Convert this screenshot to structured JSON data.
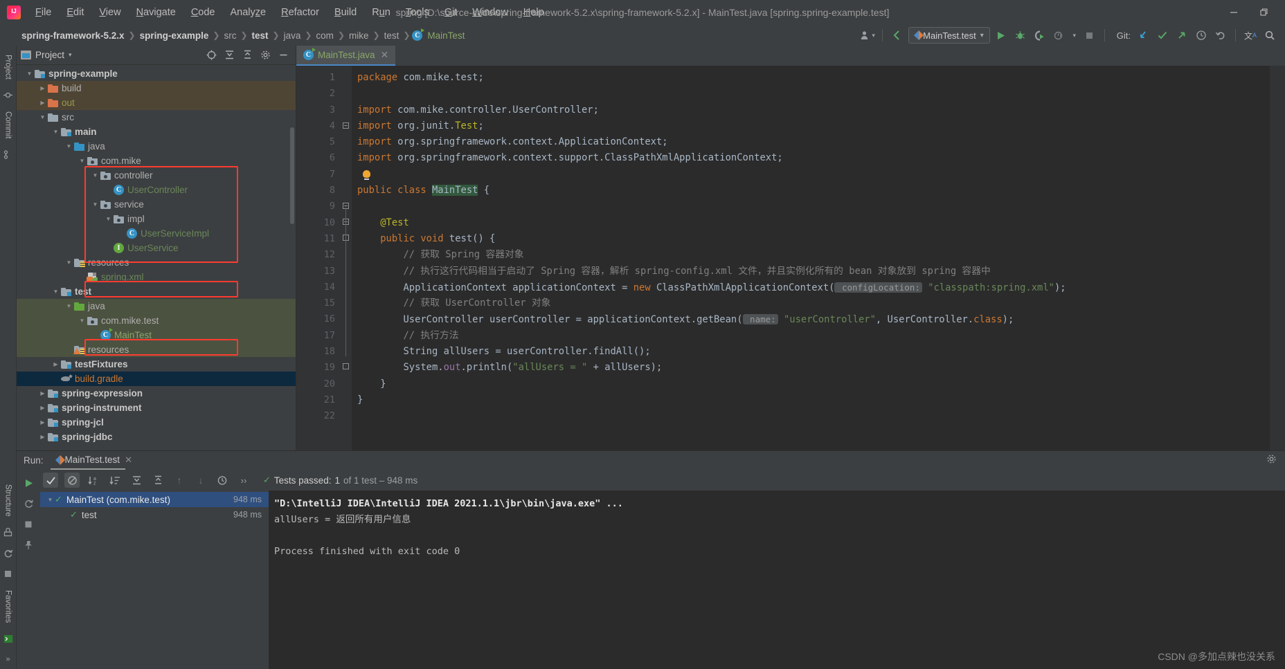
{
  "window": {
    "title": "spring [D:\\source-code\\spring-framework-5.2.x\\spring-framework-5.2.x] - MainTest.java [spring.spring-example.test]",
    "minimize": "—",
    "restore": "❐"
  },
  "menubar": {
    "items": [
      {
        "label": "File",
        "mnemonic": "F"
      },
      {
        "label": "Edit",
        "mnemonic": "E"
      },
      {
        "label": "View",
        "mnemonic": "V"
      },
      {
        "label": "Navigate",
        "mnemonic": "N"
      },
      {
        "label": "Code",
        "mnemonic": "C"
      },
      {
        "label": "Analyze",
        "mnemonic": "z"
      },
      {
        "label": "Refactor",
        "mnemonic": "R"
      },
      {
        "label": "Build",
        "mnemonic": "B"
      },
      {
        "label": "Run",
        "mnemonic": "u"
      },
      {
        "label": "Tools",
        "mnemonic": "T"
      },
      {
        "label": "Git",
        "mnemonic": "G"
      },
      {
        "label": "Window",
        "mnemonic": "W"
      },
      {
        "label": "Help",
        "mnemonic": "H"
      }
    ]
  },
  "breadcrumb": {
    "items": [
      {
        "label": "spring-framework-5.2.x",
        "style": "bold"
      },
      {
        "label": "spring-example",
        "style": "bold"
      },
      {
        "label": "src",
        "style": "normal"
      },
      {
        "label": "test",
        "style": "bold"
      },
      {
        "label": "java",
        "style": "normal"
      },
      {
        "label": "com",
        "style": "normal"
      },
      {
        "label": "mike",
        "style": "normal"
      },
      {
        "label": "test",
        "style": "normal"
      },
      {
        "label": "MainTest",
        "style": "file"
      }
    ],
    "separator": "❯"
  },
  "toolbar": {
    "run_configuration": "MainTest.test",
    "dropdown_caret": "▾",
    "git_label": "Git:",
    "run_button": "▶",
    "debug_button": "🐞",
    "coverage_button": "▶",
    "profile_button": "◷",
    "stop_button": "■",
    "update_project": "↙",
    "commit": "✓",
    "push": "↗",
    "history": "◷",
    "undo": "↺",
    "translate": "文A",
    "search": "🔍"
  },
  "left_strip": {
    "tabs": [
      "Project",
      "Commit",
      "Structure",
      "Favorites"
    ]
  },
  "project_panel": {
    "title": "Project",
    "caret": "▾",
    "actions": [
      "select-opened-file-icon",
      "expand-all-icon",
      "collapse-all-icon",
      "settings-icon",
      "hide-icon"
    ],
    "tree": [
      {
        "label": "spring-example",
        "depth": 1,
        "arrow": "down",
        "icon": "module-folder",
        "bold": true,
        "color": "#c8c8c8",
        "highlight": "none"
      },
      {
        "label": "build",
        "depth": 2,
        "arrow": "right",
        "icon": "orange-folder",
        "bold": false,
        "color": "#b0b0b0",
        "highlight": "build"
      },
      {
        "label": "out",
        "depth": 2,
        "arrow": "right",
        "icon": "orange-folder",
        "bold": false,
        "color": "#9c9a4e",
        "highlight": "build"
      },
      {
        "label": "src",
        "depth": 2,
        "arrow": "down",
        "icon": "plain-folder",
        "bold": false,
        "color": "#b0b0b0",
        "highlight": "none"
      },
      {
        "label": "main",
        "depth": 3,
        "arrow": "down",
        "icon": "module-folder",
        "bold": true,
        "color": "#c8c8c8",
        "highlight": "none"
      },
      {
        "label": "java",
        "depth": 4,
        "arrow": "down",
        "icon": "blue-folder",
        "bold": false,
        "color": "#b0b0b0",
        "highlight": "none"
      },
      {
        "label": "com.mike",
        "depth": 5,
        "arrow": "down",
        "icon": "package",
        "bold": false,
        "color": "#b0b0b0",
        "highlight": "none"
      },
      {
        "label": "controller",
        "depth": 6,
        "arrow": "down",
        "icon": "package",
        "bold": false,
        "color": "#b0b0b0",
        "highlight": "none"
      },
      {
        "label": "UserController",
        "depth": 7,
        "arrow": "none",
        "icon": "class",
        "bold": false,
        "color": "#6a8759",
        "highlight": "none"
      },
      {
        "label": "service",
        "depth": 6,
        "arrow": "down",
        "icon": "package",
        "bold": false,
        "color": "#b0b0b0",
        "highlight": "none"
      },
      {
        "label": "impl",
        "depth": 7,
        "arrow": "down",
        "icon": "package",
        "bold": false,
        "color": "#b0b0b0",
        "highlight": "none"
      },
      {
        "label": "UserServiceImpl",
        "depth": 8,
        "arrow": "none",
        "icon": "class",
        "bold": false,
        "color": "#6a8759",
        "highlight": "none"
      },
      {
        "label": "UserService",
        "depth": 7,
        "arrow": "none",
        "icon": "interface",
        "bold": false,
        "color": "#6a8759",
        "highlight": "none"
      },
      {
        "label": "resources",
        "depth": 4,
        "arrow": "down",
        "icon": "resources-folder",
        "bold": false,
        "color": "#b0b0b0",
        "highlight": "none"
      },
      {
        "label": "spring.xml",
        "depth": 5,
        "arrow": "none",
        "icon": "spring-xml",
        "bold": false,
        "color": "#6a8759",
        "highlight": "none"
      },
      {
        "label": "test",
        "depth": 3,
        "arrow": "down",
        "icon": "module-folder",
        "bold": true,
        "color": "#c8c8c8",
        "highlight": "none"
      },
      {
        "label": "java",
        "depth": 4,
        "arrow": "down",
        "icon": "green-folder",
        "bold": false,
        "color": "#b0b0b0",
        "highlight": "test"
      },
      {
        "label": "com.mike.test",
        "depth": 5,
        "arrow": "down",
        "icon": "package",
        "bold": false,
        "color": "#b0b0b0",
        "highlight": "test"
      },
      {
        "label": "MainTest",
        "depth": 6,
        "arrow": "none",
        "icon": "class-run",
        "bold": false,
        "color": "#8aa76a",
        "highlight": "test"
      },
      {
        "label": "resources",
        "depth": 4,
        "arrow": "none",
        "icon": "test-resources-folder",
        "bold": false,
        "color": "#b0b0b0",
        "highlight": "test"
      },
      {
        "label": "testFixtures",
        "depth": 3,
        "arrow": "right",
        "icon": "module-folder",
        "bold": true,
        "color": "#c8c8c8",
        "highlight": "none"
      },
      {
        "label": "build.gradle",
        "depth": 3,
        "arrow": "none",
        "icon": "gradle",
        "bold": false,
        "color": "#cc7832",
        "highlight": "selected"
      },
      {
        "label": "spring-expression",
        "depth": 2,
        "arrow": "right",
        "icon": "module-folder",
        "bold": true,
        "color": "#c8c8c8",
        "highlight": "none"
      },
      {
        "label": "spring-instrument",
        "depth": 2,
        "arrow": "right",
        "icon": "module-folder",
        "bold": true,
        "color": "#c8c8c8",
        "highlight": "none"
      },
      {
        "label": "spring-jcl",
        "depth": 2,
        "arrow": "right",
        "icon": "module-folder",
        "bold": true,
        "color": "#c8c8c8",
        "highlight": "none"
      },
      {
        "label": "spring-jdbc",
        "depth": 2,
        "arrow": "right",
        "icon": "module-folder",
        "bold": true,
        "color": "#c8c8c8",
        "highlight": "none"
      }
    ]
  },
  "editor": {
    "tab": {
      "label": "MainTest.java",
      "close": "✕",
      "icon": "class-run-icon"
    },
    "line_numbers": [
      "1",
      "2",
      "3",
      "4",
      "5",
      "6",
      "7",
      "8",
      "9",
      "10",
      "11",
      "12",
      "13",
      "14",
      "15",
      "16",
      "17",
      "18",
      "19",
      "20",
      "21",
      "22"
    ],
    "code_lines": [
      {
        "n": 1,
        "html": "<span class=\"kw\">package</span> com.mike.test;"
      },
      {
        "n": 2,
        "html": ""
      },
      {
        "n": 3,
        "html": "<span class=\"kw\">import</span> com.mike.controller.UserController;"
      },
      {
        "n": 4,
        "html": "<span class=\"kw\">import</span> org.junit.<span class=\"ann\">Test</span>;"
      },
      {
        "n": 5,
        "html": "<span class=\"kw\">import</span> org.springframework.context.ApplicationContext;"
      },
      {
        "n": 6,
        "html": "<span class=\"kw\">import</span> org.springframework.context.support.ClassPathXmlApplicationContext;"
      },
      {
        "n": 7,
        "html": ""
      },
      {
        "n": 8,
        "html": "<span class=\"kw\">public class</span> <span class=\"hl\">MainTest</span> {"
      },
      {
        "n": 9,
        "html": ""
      },
      {
        "n": 10,
        "html": "    <span class=\"ann\">@Test</span>"
      },
      {
        "n": 11,
        "html": "    <span class=\"kw\">public void</span> test() {"
      },
      {
        "n": 12,
        "html": "        <span class=\"cmt\">// 获取 Spring 容器对象</span>"
      },
      {
        "n": 13,
        "html": "        <span class=\"cmt\">// 执行这行代码相当于启动了 Spring 容器，解析 spring-config.xml 文件，并且实例化所有的 bean 对象放到 spring 容器中</span>"
      },
      {
        "n": 14,
        "html": "        ApplicationContext applicationContext = <span class=\"kw\">new</span> ClassPathXmlApplicationContext(<span class=\"hint\"> configLocation:</span> <span class=\"str\">\"classpath:spring.xml\"</span>);"
      },
      {
        "n": 15,
        "html": "        <span class=\"cmt\">// 获取 UserController 对象</span>"
      },
      {
        "n": 16,
        "html": "        UserController userController = applicationContext.getBean(<span class=\"hint\"> name:</span> <span class=\"str\">\"userController\"</span>, UserController.<span class=\"kw\">class</span>);"
      },
      {
        "n": 17,
        "html": "        <span class=\"cmt\">// 执行方法</span>"
      },
      {
        "n": 18,
        "html": "        String allUsers = userController.findAll();"
      },
      {
        "n": 19,
        "html": "        System.<span class=\"fld\">out</span>.println(<span class=\"str\">\"allUsers = \"</span> + allUsers);"
      },
      {
        "n": 20,
        "html": "    }"
      },
      {
        "n": 21,
        "html": "}"
      },
      {
        "n": 22,
        "html": ""
      }
    ],
    "run_gutter_lines": [
      8,
      11
    ],
    "bulb_line": 7
  },
  "run_panel": {
    "label": "Run:",
    "tab": "MainTest.test",
    "tab_close": "✕",
    "gear": "⚙",
    "actions": [
      {
        "name": "rerun-button",
        "glyph": "▶"
      },
      {
        "name": "show-passed-toggle",
        "glyph": "✓"
      },
      {
        "name": "show-ignored-toggle",
        "glyph": "⊘"
      },
      {
        "name": "sort-alphabetically-button",
        "glyph": "↓a"
      },
      {
        "name": "sort-by-duration-button",
        "glyph": "↓≡"
      },
      {
        "name": "expand-all-button",
        "glyph": "⤓"
      },
      {
        "name": "collapse-all-button",
        "glyph": "⤒"
      },
      {
        "name": "previous-failed-test-button",
        "glyph": "↑"
      },
      {
        "name": "next-failed-test-button",
        "glyph": "↓"
      },
      {
        "name": "test-history-button",
        "glyph": "◷"
      },
      {
        "name": "expand-status-button",
        "glyph": "››"
      }
    ],
    "left_toolbar": [
      {
        "name": "rerun-icon",
        "glyph": "▶"
      },
      {
        "name": "rerun-failed-icon",
        "glyph": "⟳"
      },
      {
        "name": "stop-icon",
        "glyph": "■"
      },
      {
        "name": "pin-icon",
        "glyph": "📌"
      }
    ],
    "status": {
      "check": "✓",
      "prefix": "Tests passed:",
      "count": "1",
      "suffix": "of 1 test – 948 ms"
    },
    "test_tree": [
      {
        "label": "MainTest (com.mike.test)",
        "duration": "948 ms",
        "arrow": "down",
        "depth": 1,
        "selected": true
      },
      {
        "label": "test",
        "duration": "948 ms",
        "arrow": "none",
        "depth": 2,
        "selected": false
      }
    ],
    "console_lines": [
      {
        "text": "\"D:\\IntelliJ IDEA\\IntelliJ IDEA 2021.1.1\\jbr\\bin\\java.exe\" ...",
        "style": "bold"
      },
      {
        "text": "allUsers = 返回所有用户信息",
        "style": "normal"
      },
      {
        "text": "",
        "style": "normal"
      },
      {
        "text": "Process finished with exit code 0",
        "style": "normal"
      }
    ]
  },
  "watermark": "CSDN @多加点辣也没关系",
  "colors": {
    "accent_blue": "#4a88c7",
    "green": "#59a869",
    "orange": "#cc7832",
    "string_green": "#6a8759",
    "highlight_red": "#ff3b30",
    "selected_blue": "#0d293e",
    "test_scope": "#4c5240",
    "build_scope": "#4f4535"
  }
}
